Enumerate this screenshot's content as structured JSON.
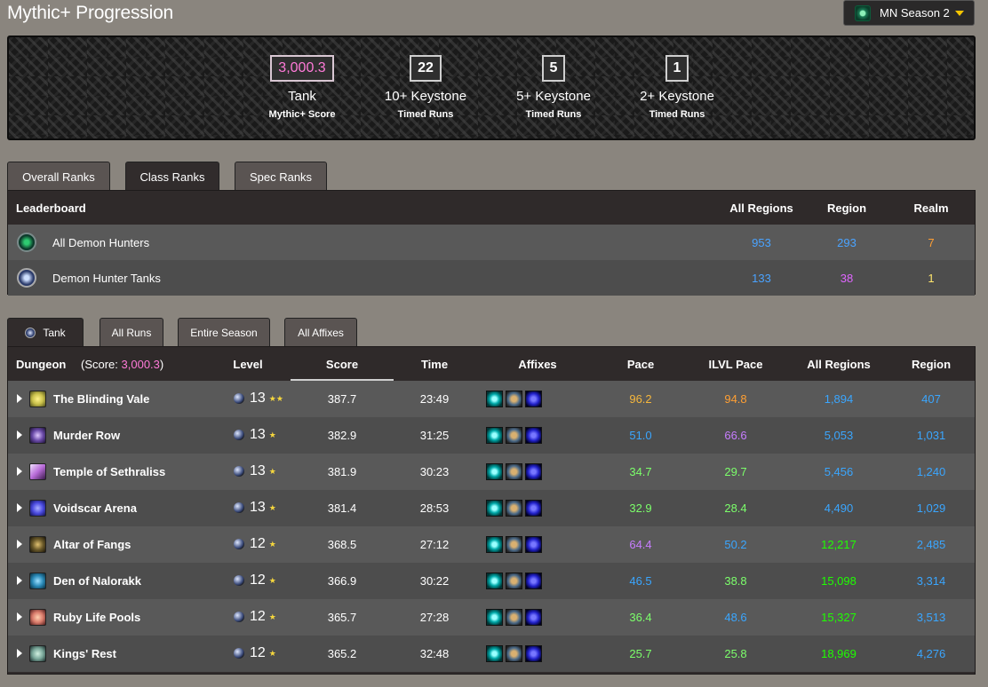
{
  "page": {
    "title": "Mythic+ Progression"
  },
  "season": {
    "label": "MN Season 2",
    "icon": "season-gem-icon"
  },
  "banner": {
    "stats": [
      {
        "value": "3,000.3",
        "label": "Tank",
        "sub": "Mythic+ Score"
      },
      {
        "value": "22",
        "label": "10+ Keystone",
        "sub": "Timed Runs"
      },
      {
        "value": "5",
        "label": "5+ Keystone",
        "sub": "Timed Runs"
      },
      {
        "value": "1",
        "label": "2+ Keystone",
        "sub": "Timed Runs"
      }
    ]
  },
  "rank_tabs": [
    {
      "label": "Overall Ranks",
      "active": false
    },
    {
      "label": "Class Ranks",
      "active": true
    },
    {
      "label": "Spec Ranks",
      "active": false
    }
  ],
  "leaderboard": {
    "headers": {
      "name": "Leaderboard",
      "all_regions": "All Regions",
      "region": "Region",
      "realm": "Realm"
    },
    "rows": [
      {
        "name": "All Demon Hunters",
        "all_regions": "953",
        "region": "293",
        "realm": "7"
      },
      {
        "name": "Demon Hunter Tanks",
        "all_regions": "133",
        "region": "38",
        "realm": "1"
      }
    ]
  },
  "run_tabs": [
    {
      "label": "Tank",
      "active": true
    },
    {
      "label": "All Runs",
      "active": false
    },
    {
      "label": "Entire Season",
      "active": false
    },
    {
      "label": "All Affixes",
      "active": false
    }
  ],
  "dungeons": {
    "headers": {
      "dungeon": "Dungeon",
      "score_prefix": "(Score: ",
      "score_value": "3,000.3",
      "score_suffix": ")",
      "level": "Level",
      "score": "Score",
      "time": "Time",
      "affixes": "Affixes",
      "pace": "Pace",
      "ilvl_pace": "ILVL Pace",
      "all_regions": "All Regions",
      "region": "Region"
    },
    "rows": [
      {
        "name": "The Blinding Vale",
        "level": "13",
        "stars": "★★",
        "score": "387.7",
        "time": "23:49",
        "pace": "96.2",
        "ilvl_pace": "94.8",
        "all_regions": "1,894",
        "region": "407",
        "icon_color": "#c9c04a"
      },
      {
        "name": "Murder Row",
        "level": "13",
        "stars": "★",
        "score": "382.9",
        "time": "31:25",
        "pace": "51.0",
        "ilvl_pace": "66.6",
        "all_regions": "5,053",
        "region": "1,031",
        "icon_color": "#6a4aa8"
      },
      {
        "name": "Temple of Sethraliss",
        "level": "13",
        "stars": "★",
        "score": "381.9",
        "time": "30:23",
        "pace": "34.7",
        "ilvl_pace": "29.7",
        "all_regions": "5,456",
        "region": "1,240",
        "icon_color": "#b86bd8"
      },
      {
        "name": "Voidscar Arena",
        "level": "13",
        "stars": "★",
        "score": "381.4",
        "time": "28:53",
        "pace": "32.9",
        "ilvl_pace": "28.4",
        "all_regions": "4,490",
        "region": "1,029",
        "icon_color": "#4a4ae0"
      },
      {
        "name": "Altar of Fangs",
        "level": "12",
        "stars": "★",
        "score": "368.5",
        "time": "27:12",
        "pace": "64.4",
        "ilvl_pace": "50.2",
        "all_regions": "12,217",
        "region": "2,485",
        "icon_color": "#6b5a2a"
      },
      {
        "name": "Den of Nalorakk",
        "level": "12",
        "stars": "★",
        "score": "366.9",
        "time": "30:22",
        "pace": "46.5",
        "ilvl_pace": "38.8",
        "all_regions": "15,098",
        "region": "3,314",
        "icon_color": "#2a8ab8"
      },
      {
        "name": "Ruby Life Pools",
        "level": "12",
        "stars": "★",
        "score": "365.7",
        "time": "27:28",
        "pace": "36.4",
        "ilvl_pace": "48.6",
        "all_regions": "15,327",
        "region": "3,513",
        "icon_color": "#d87a6a"
      },
      {
        "name": "Kings' Rest",
        "level": "12",
        "stars": "★",
        "score": "365.2",
        "time": "32:48",
        "pace": "25.7",
        "ilvl_pace": "25.8",
        "all_regions": "18,969",
        "region": "4,276",
        "icon_color": "#7aa89a"
      }
    ]
  }
}
